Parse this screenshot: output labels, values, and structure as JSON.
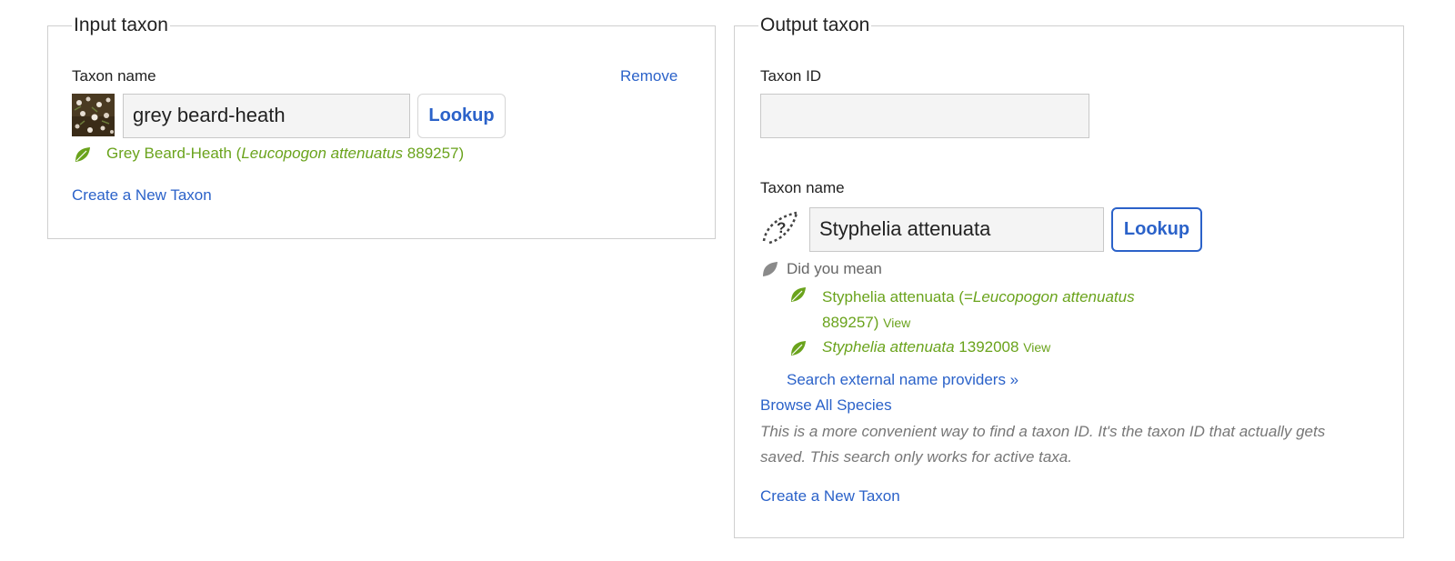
{
  "input": {
    "legend": "Input taxon",
    "taxon_name_label": "Taxon name",
    "remove_label": "Remove",
    "name_value": "grey beard-heath",
    "lookup_label": "Lookup",
    "selected": {
      "common": "Grey Beard-Heath (",
      "scientific": "Leucopogon attenuatus",
      "id_suffix": " 889257)"
    },
    "create_label": "Create a New Taxon"
  },
  "output": {
    "legend": "Output taxon",
    "taxon_id_label": "Taxon ID",
    "taxon_id_value": "",
    "taxon_name_label": "Taxon name",
    "name_value": "Styphelia attenuata",
    "lookup_label": "Lookup",
    "did_you_mean": "Did you mean",
    "suggestions": [
      {
        "line1_prefix": "Styphelia attenuata (=",
        "line1_italic": "Leucopogon attenuatus",
        "line2": "889257)",
        "view": "View"
      },
      {
        "italic": "Styphelia attenuata",
        "suffix": " 1392008",
        "view": "View"
      }
    ],
    "search_external": "Search external name providers »",
    "browse_all": "Browse All Species",
    "hint_line1": "This is a more convenient way to find a taxon ID. It's the taxon ID that actually gets",
    "hint_line2": "saved. This search only works for active taxa.",
    "create_label": "Create a New Taxon"
  },
  "colors": {
    "link": "#2b62c9",
    "taxon_green": "#6aa31c",
    "border": "#cfcfcf"
  },
  "icons": {
    "leaf": "leaf-icon",
    "unknown_taxon": "unknown-taxon-icon"
  }
}
